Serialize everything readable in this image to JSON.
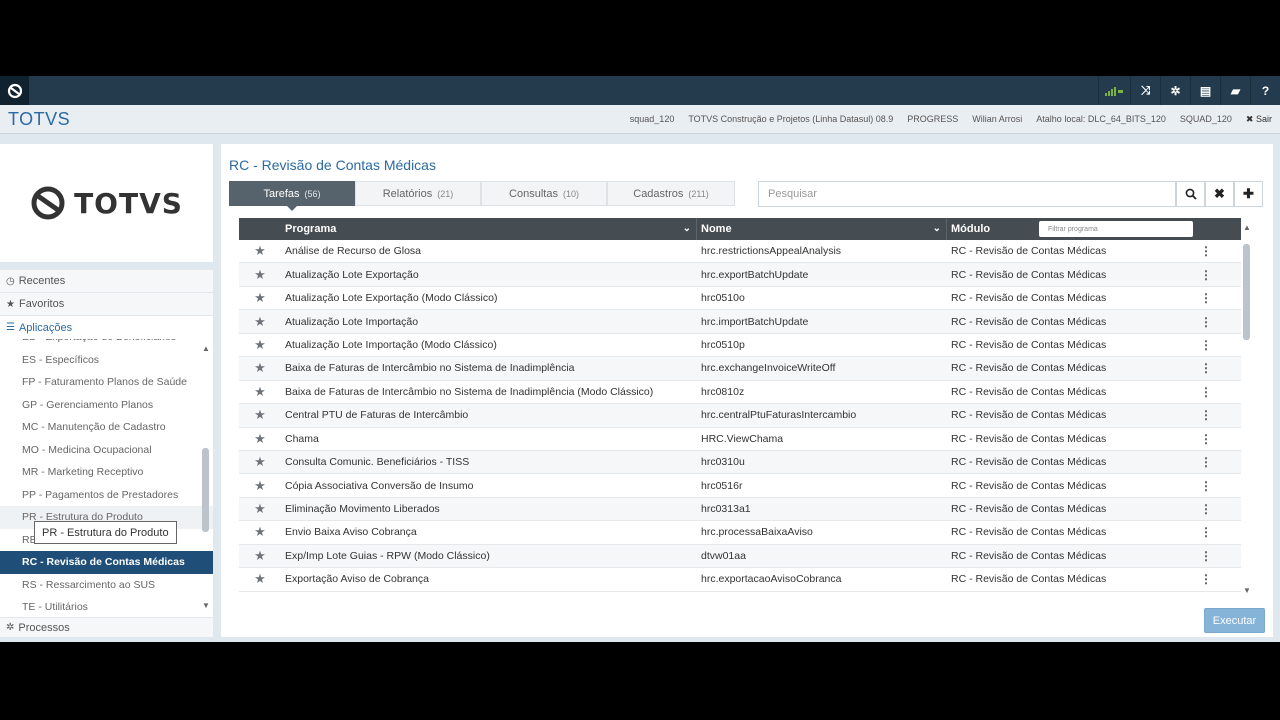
{
  "topbar": {
    "icons": [
      "signal-icon",
      "shuffle-icon",
      "gear-icon",
      "document-icon",
      "chat-icon",
      "help-icon"
    ]
  },
  "header": {
    "brand": "TOTVS",
    "info": [
      "squad_120",
      "TOTVS Construção e Projetos (Linha Datasul) 08.9",
      "PROGRESS",
      "Wilian Arrosi",
      "Atalho local: DLC_64_BITS_120",
      "SQUAD_120"
    ],
    "logout": "Sair"
  },
  "logo_card": {
    "text": "TOTVS"
  },
  "nav": {
    "recentes": "Recentes",
    "favoritos": "Favoritos",
    "aplicacoes": "Aplicações",
    "processos": "Processos",
    "apps": [
      "EB - Exportação de Beneficiários",
      "ES - Específicos",
      "FP - Faturamento Planos de Saúde",
      "GP - Gerenciamento Planos",
      "MC - Manutenção de Cadastro",
      "MO - Medicina Ocupacional",
      "MR - Marketing Receptivo",
      "PP - Pagamentos de Prestadores",
      "PR - Estrutura do Produto",
      "RE - Reembolso",
      "RC - Revisão de Contas Médicas",
      "RS - Ressarcimento ao SUS",
      "TE - Utilitários"
    ],
    "tooltip": "PR - Estrutura do Produto"
  },
  "main": {
    "title": "RC - Revisão de Contas Médicas",
    "tabs": [
      {
        "label": "Tarefas",
        "count": "(56)"
      },
      {
        "label": "Relatórios",
        "count": "(21)"
      },
      {
        "label": "Consultas",
        "count": "(10)"
      },
      {
        "label": "Cadastros",
        "count": "(211)"
      }
    ],
    "search_placeholder": "Pesquisar",
    "execute": "Executar"
  },
  "grid": {
    "headers": {
      "programa": "Programa",
      "nome": "Nome",
      "modulo": "Módulo",
      "filter_placeholder": "Filtrar programa"
    },
    "rows": [
      {
        "programa": "Análise de Recurso de Glosa",
        "nome": "hrc.restrictionsAppealAnalysis",
        "modulo": "RC - Revisão de Contas Médicas"
      },
      {
        "programa": "Atualização Lote Exportação",
        "nome": "hrc.exportBatchUpdate",
        "modulo": "RC - Revisão de Contas Médicas"
      },
      {
        "programa": "Atualização Lote Exportação (Modo Clássico)",
        "nome": "hrc0510o",
        "modulo": "RC - Revisão de Contas Médicas"
      },
      {
        "programa": "Atualização Lote Importação",
        "nome": "hrc.importBatchUpdate",
        "modulo": "RC - Revisão de Contas Médicas"
      },
      {
        "programa": "Atualização Lote Importação (Modo Clássico)",
        "nome": "hrc0510p",
        "modulo": "RC - Revisão de Contas Médicas"
      },
      {
        "programa": "Baixa de Faturas de Intercâmbio no Sistema de Inadimplência",
        "nome": "hrc.exchangeInvoiceWriteOff",
        "modulo": "RC - Revisão de Contas Médicas"
      },
      {
        "programa": "Baixa de Faturas de Intercâmbio no Sistema de Inadimplência (Modo Clássico)",
        "nome": "hrc0810z",
        "modulo": "RC - Revisão de Contas Médicas"
      },
      {
        "programa": "Central PTU de Faturas de Intercâmbio",
        "nome": "hrc.centralPtuFaturasIntercambio",
        "modulo": "RC - Revisão de Contas Médicas"
      },
      {
        "programa": "Chama",
        "nome": "HRC.ViewChama",
        "modulo": "RC - Revisão de Contas Médicas"
      },
      {
        "programa": "Consulta Comunic. Beneficiários - TISS",
        "nome": "hrc0310u",
        "modulo": "RC - Revisão de Contas Médicas"
      },
      {
        "programa": "Cópia Associativa Conversão de Insumo",
        "nome": "hrc0516r",
        "modulo": "RC - Revisão de Contas Médicas"
      },
      {
        "programa": "Eliminação Movimento Liberados",
        "nome": "hrc0313a1",
        "modulo": "RC - Revisão de Contas Médicas"
      },
      {
        "programa": "Envio Baixa Aviso Cobrança",
        "nome": "hrc.processaBaixaAviso",
        "modulo": "RC - Revisão de Contas Médicas"
      },
      {
        "programa": "Exp/Imp Lote Guias - RPW (Modo Clássico)",
        "nome": "dtvw01aa",
        "modulo": "RC - Revisão de Contas Médicas"
      },
      {
        "programa": "Exportação Aviso de Cobrança",
        "nome": "hrc.exportacaoAvisoCobranca",
        "modulo": "RC - Revisão de Contas Médicas"
      }
    ]
  },
  "colors": {
    "topbar": "#243b4d",
    "accent": "#2b6aa3",
    "active_app": "#1f4f78",
    "grid_header": "#454c52"
  }
}
